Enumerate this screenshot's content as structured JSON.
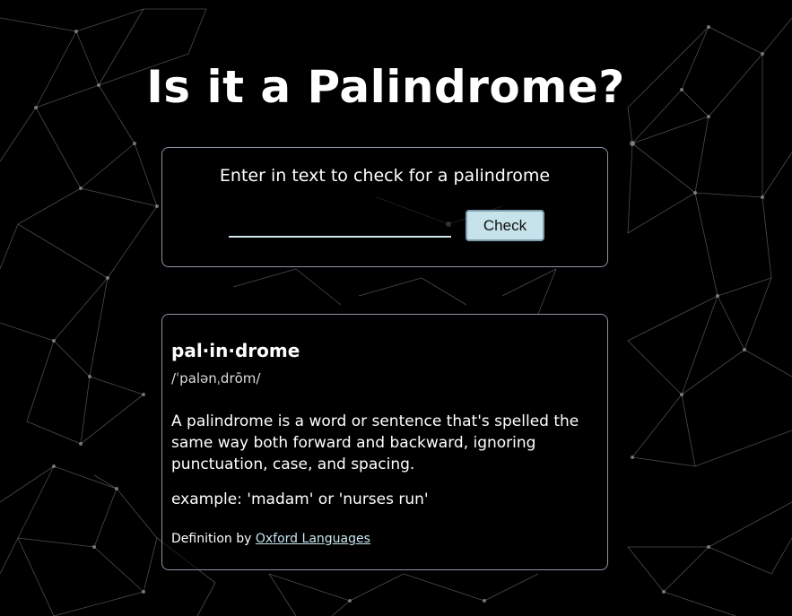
{
  "page": {
    "title": "Is it a Palindrome?"
  },
  "checker": {
    "prompt": "Enter in text to check for a palindrome",
    "input_value": "",
    "input_placeholder": "",
    "check_label": "Check"
  },
  "definition": {
    "word": "pal·in·drome",
    "pronunciation": "/ˈpalənˌdrōm/",
    "text": "A palindrome is a word or sentence that's spelled the same way both forward and backward, ignoring punctuation, case, and spacing.",
    "example": "example: 'madam' or 'nurses run'",
    "attribution_prefix": "Definition by",
    "attribution_link": "Oxford Languages"
  },
  "colors": {
    "background": "#000000",
    "card_border": "#8c95a3",
    "button_bg": "#c6e2ea",
    "link": "#c6e6ef"
  }
}
